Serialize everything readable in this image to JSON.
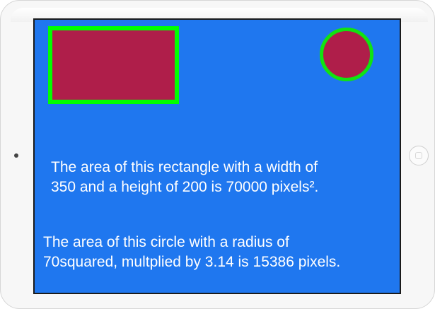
{
  "screen": {
    "background_color": "#1f77ef",
    "rectangle": {
      "fill_color": "#af1e4a",
      "border_color": "#00ff00"
    },
    "circle": {
      "fill_color": "#af1e4a",
      "border_color": "#11e311"
    },
    "messages": {
      "rectangle_line1": "The area of this rectangle with a width of",
      "rectangle_line2": "350 and a height of 200 is 70000 pixels².",
      "circle_line1": "The area of this circle with a radius of",
      "circle_line2": "70squared, multplied by 3.14 is 15386 pixels."
    }
  },
  "device": {
    "home_button_icon": "home-button-icon",
    "camera_icon": "camera-icon"
  }
}
